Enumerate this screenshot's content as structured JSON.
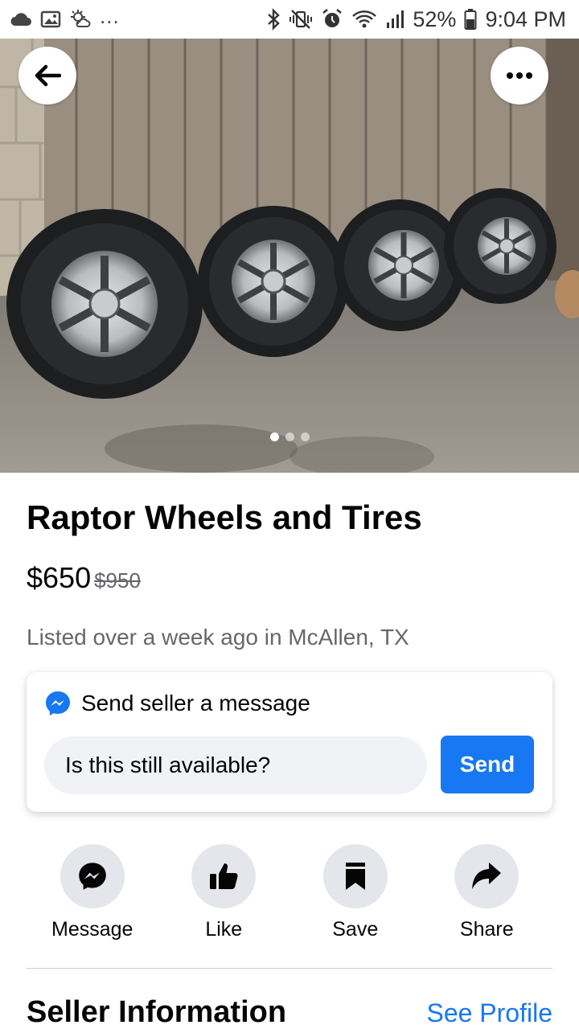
{
  "status_bar": {
    "left_icons": [
      "cloud-icon",
      "image-icon",
      "weather-icon"
    ],
    "overflow": "...",
    "right_icons": [
      "bluetooth-icon",
      "vibrate-icon",
      "alarm-icon",
      "wifi-icon",
      "signal-icon",
      "battery-icon"
    ],
    "battery": "52%",
    "time": "9:04 PM"
  },
  "hero": {
    "icons": {
      "back": "back-arrow-icon",
      "more": "more-icon"
    },
    "photo_count": 3,
    "current_photo": 1
  },
  "listing": {
    "title": "Raptor Wheels and Tires",
    "price": "$650",
    "original_price": "$950",
    "listed": "Listed over a week ago in McAllen, TX"
  },
  "message_card": {
    "heading": "Send seller a message",
    "input_value": "Is this still available?",
    "send_label": "Send",
    "icon": "messenger-icon"
  },
  "actions": [
    {
      "label": "Message",
      "icon": "messenger-icon"
    },
    {
      "label": "Like",
      "icon": "thumbs-up-icon"
    },
    {
      "label": "Save",
      "icon": "bookmark-icon"
    },
    {
      "label": "Share",
      "icon": "share-icon"
    }
  ],
  "seller": {
    "heading": "Seller Information",
    "link": "See Profile"
  },
  "colors": {
    "accent": "#1877f2",
    "secondary_text": "#65676b",
    "button_bg": "#e4e6eb",
    "input_bg": "#f0f2f5"
  }
}
